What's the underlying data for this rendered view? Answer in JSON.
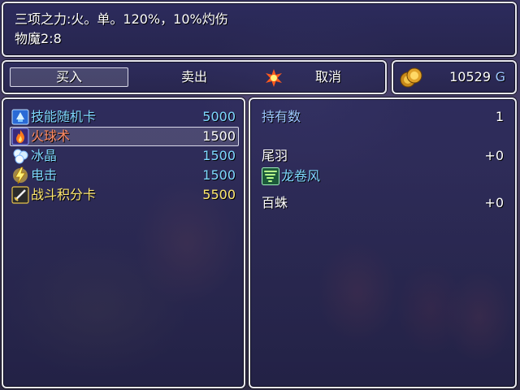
{
  "help": {
    "line1": "三项之力:火。单。120%，10%灼伤",
    "line2": "物魔2:8"
  },
  "command": {
    "buy_label": "买入",
    "sell_label": "卖出",
    "cancel_label": "取消",
    "selected": "buy"
  },
  "gold": {
    "amount": "10529",
    "unit": "G"
  },
  "shop_items": [
    {
      "icon": "skill-card-icon",
      "name": "技能随机卡",
      "price": "5000"
    },
    {
      "icon": "fire-icon",
      "name": "火球术",
      "price": "1500"
    },
    {
      "icon": "ice-crystal-icon",
      "name": "冰晶",
      "price": "1500"
    },
    {
      "icon": "lightning-icon",
      "name": "电击",
      "price": "1500"
    },
    {
      "icon": "sword-card-icon",
      "name": "战斗积分卡",
      "price": "5500"
    }
  ],
  "status": {
    "possession_label": "持有数",
    "possession_count": "1",
    "party": [
      {
        "name": "尾羽",
        "change": "+0"
      },
      {
        "name": "龙卷风"
      },
      {
        "name": "百蛛",
        "change": "+0"
      }
    ]
  },
  "colors": {
    "frame_border": "#e8e8f0",
    "window_fill": "#28285a",
    "skill_text": "#7fd8ff",
    "fire_text": "#ff8a60",
    "card_text": "#ffe870"
  }
}
